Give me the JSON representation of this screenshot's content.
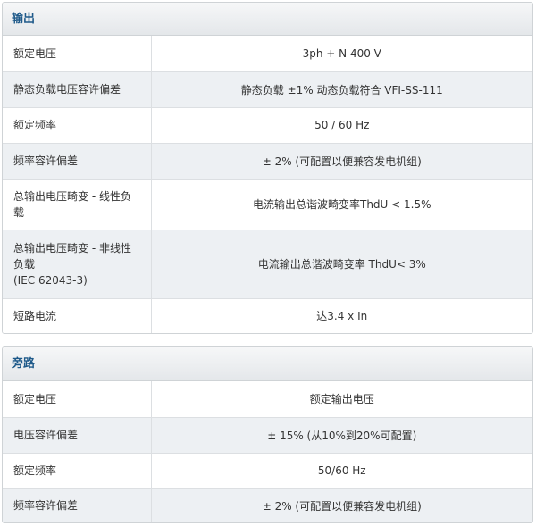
{
  "output": {
    "title": "输出",
    "rows": [
      {
        "label": "额定电压",
        "value": "3ph + N 400 V"
      },
      {
        "label": "静态负载电压容许偏差",
        "value": "静态负载 ±1% 动态负载符合 VFI-SS-111"
      },
      {
        "label": "额定频率",
        "value": "50 / 60 Hz"
      },
      {
        "label": "频率容许偏差",
        "value": "± 2% (可配置以便兼容发电机组)"
      },
      {
        "label": "总输出电压畸变 - 线性负载",
        "value": "电流输出总谐波畸变率ThdU < 1.5%"
      },
      {
        "label": "总输出电压畸变 - 非线性负载\n(IEC 62043-3)",
        "value": "电流输出总谐波畸变率 ThdU< 3%"
      },
      {
        "label": "短路电流",
        "value": "达3.4 x In"
      }
    ]
  },
  "bypass": {
    "title": "旁路",
    "rows": [
      {
        "label": "额定电压",
        "value": "额定输出电压"
      },
      {
        "label": "电压容许偏差",
        "value": "± 15% (从10%到20%可配置)"
      },
      {
        "label": "额定频率",
        "value": "50/60 Hz"
      },
      {
        "label": "频率容许偏差",
        "value": "± 2% (可配置以便兼容发电机组)"
      }
    ]
  }
}
